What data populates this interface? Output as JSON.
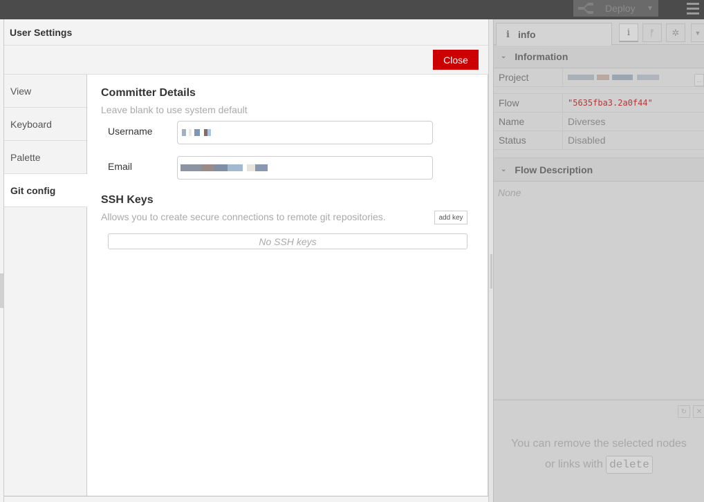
{
  "header": {
    "deploy_label": "Deploy",
    "deploy_icon": "deploy-flow-icon",
    "menu_icon": "hamburger-menu-icon"
  },
  "dialog": {
    "title": "User Settings",
    "close_label": "Close",
    "tabs": [
      {
        "label": "View",
        "active": false
      },
      {
        "label": "Keyboard",
        "active": false
      },
      {
        "label": "Palette",
        "active": false
      },
      {
        "label": "Git config",
        "active": true
      }
    ],
    "git_config": {
      "committer_title": "Committer Details",
      "committer_subtitle": "Leave blank to use system default",
      "username_label": "Username",
      "username_value": "[redacted]",
      "email_label": "Email",
      "email_value": "[redacted]",
      "ssh_title": "SSH Keys",
      "ssh_subtitle": "Allows you to create secure connections to remote git repositories.",
      "add_key_label": "add key",
      "ssh_empty": "No SSH keys"
    }
  },
  "sidebar": {
    "active_tab_label": "info",
    "tab_buttons": [
      "info-icon",
      "git-branch-icon",
      "debug-bug-icon",
      "dropdown-icon"
    ],
    "information": {
      "title": "Information",
      "rows": [
        {
          "key": "Project",
          "value": "[redacted]"
        },
        {
          "key": "Flow",
          "value": "\"5635fba3.2a0f44\""
        },
        {
          "key": "Name",
          "value": "Diverses"
        },
        {
          "key": "Status",
          "value": "Disabled"
        }
      ]
    },
    "flow_description": {
      "title": "Flow Description",
      "value": "None"
    },
    "tip": {
      "line1": "You can remove the selected nodes",
      "line2_prefix": "or links with",
      "key": "delete"
    }
  }
}
